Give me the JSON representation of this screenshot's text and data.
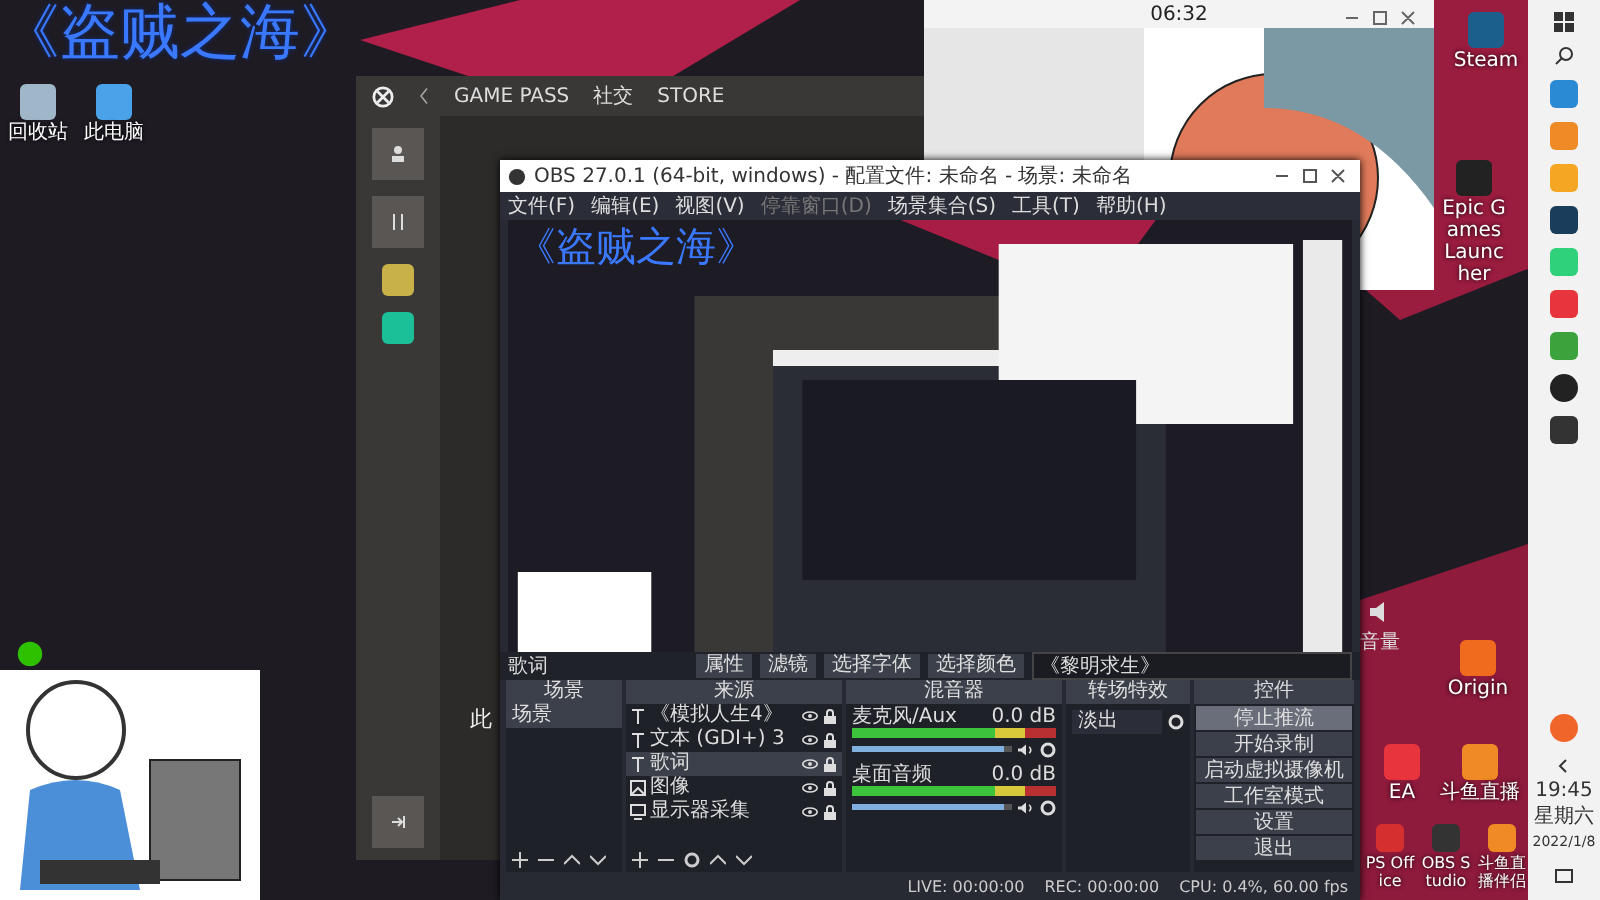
{
  "overlay_title": "《盗贼之海》",
  "desktop_icons_left": [
    {
      "label": "回收站",
      "kind": "bin"
    },
    {
      "label": "此电脑",
      "kind": "pc"
    }
  ],
  "desktop_icons_right": [
    {
      "label": "Steam",
      "kind": "steam"
    },
    {
      "label": "Epic Games Launcher",
      "kind": "epic"
    },
    {
      "label": "Origin",
      "kind": "origin"
    },
    {
      "label": "EA",
      "kind": "ea"
    },
    {
      "label": "斗鱼直播",
      "kind": "douyu"
    }
  ],
  "desktop_icons_bottom": [
    {
      "label": "PS Office",
      "kind": "wps"
    },
    {
      "label": "OBS Studio",
      "kind": "obs"
    },
    {
      "label": "斗鱼直播伴侣",
      "kind": "douyu"
    }
  ],
  "volume_widget": {
    "label": "音量"
  },
  "xbox_bar": {
    "nav": [
      "GAME PASS",
      "社交",
      "STORE"
    ],
    "side_char": "此"
  },
  "popup_window": {
    "time": "06:32"
  },
  "obs": {
    "title": "OBS 27.0.1 (64-bit, windows) - 配置文件: 未命名 - 场景: 未命名",
    "menu": [
      {
        "label": "文件(F)",
        "disabled": false
      },
      {
        "label": "编辑(E)",
        "disabled": false
      },
      {
        "label": "视图(V)",
        "disabled": false
      },
      {
        "label": "停靠窗口(D)",
        "disabled": true
      },
      {
        "label": "场景集合(S)",
        "disabled": false
      },
      {
        "label": "工具(T)",
        "disabled": false
      },
      {
        "label": "帮助(H)",
        "disabled": false
      }
    ],
    "preview_overlay_title": "《盗贼之海》",
    "source_bar": {
      "source": "歌词",
      "buttons": [
        "属性",
        "滤镜",
        "选择字体",
        "选择颜色"
      ],
      "text_value": "《黎明求生》"
    },
    "docks": {
      "scenes": "场景",
      "sources": "来源",
      "mixer": "混音器",
      "transitions": "转场特效",
      "controls": "控件"
    },
    "scenes": [
      {
        "name": "场景",
        "selected": true
      }
    ],
    "sources": [
      {
        "name": "《模拟人生4》",
        "kind": "text",
        "selected": false
      },
      {
        "name": "文本 (GDI+) 3",
        "kind": "text",
        "selected": false
      },
      {
        "name": "歌词",
        "kind": "text",
        "selected": true
      },
      {
        "name": "图像",
        "kind": "image",
        "selected": false
      },
      {
        "name": "显示器采集",
        "kind": "display",
        "selected": false
      }
    ],
    "mixer": [
      {
        "name": "麦克风/Aux",
        "reading": "0.0 dB",
        "level": 0.95
      },
      {
        "name": "桌面音频",
        "reading": "0.0 dB",
        "level": 0.95
      }
    ],
    "transition": "淡出",
    "controls": [
      {
        "label": "停止推流",
        "selected": true
      },
      {
        "label": "开始录制",
        "selected": false
      },
      {
        "label": "启动虚拟摄像机",
        "selected": false
      },
      {
        "label": "工作室模式",
        "selected": false
      },
      {
        "label": "设置",
        "selected": false
      },
      {
        "label": "退出",
        "selected": false
      }
    ],
    "status": {
      "live": "LIVE: 00:00:00",
      "rec": "REC: 00:00:00",
      "cpu": "CPU: 0.4%, 60.00 fps"
    }
  },
  "taskbar": {
    "clock": "19:45",
    "day": "星期六",
    "date": "2022/1/8"
  }
}
